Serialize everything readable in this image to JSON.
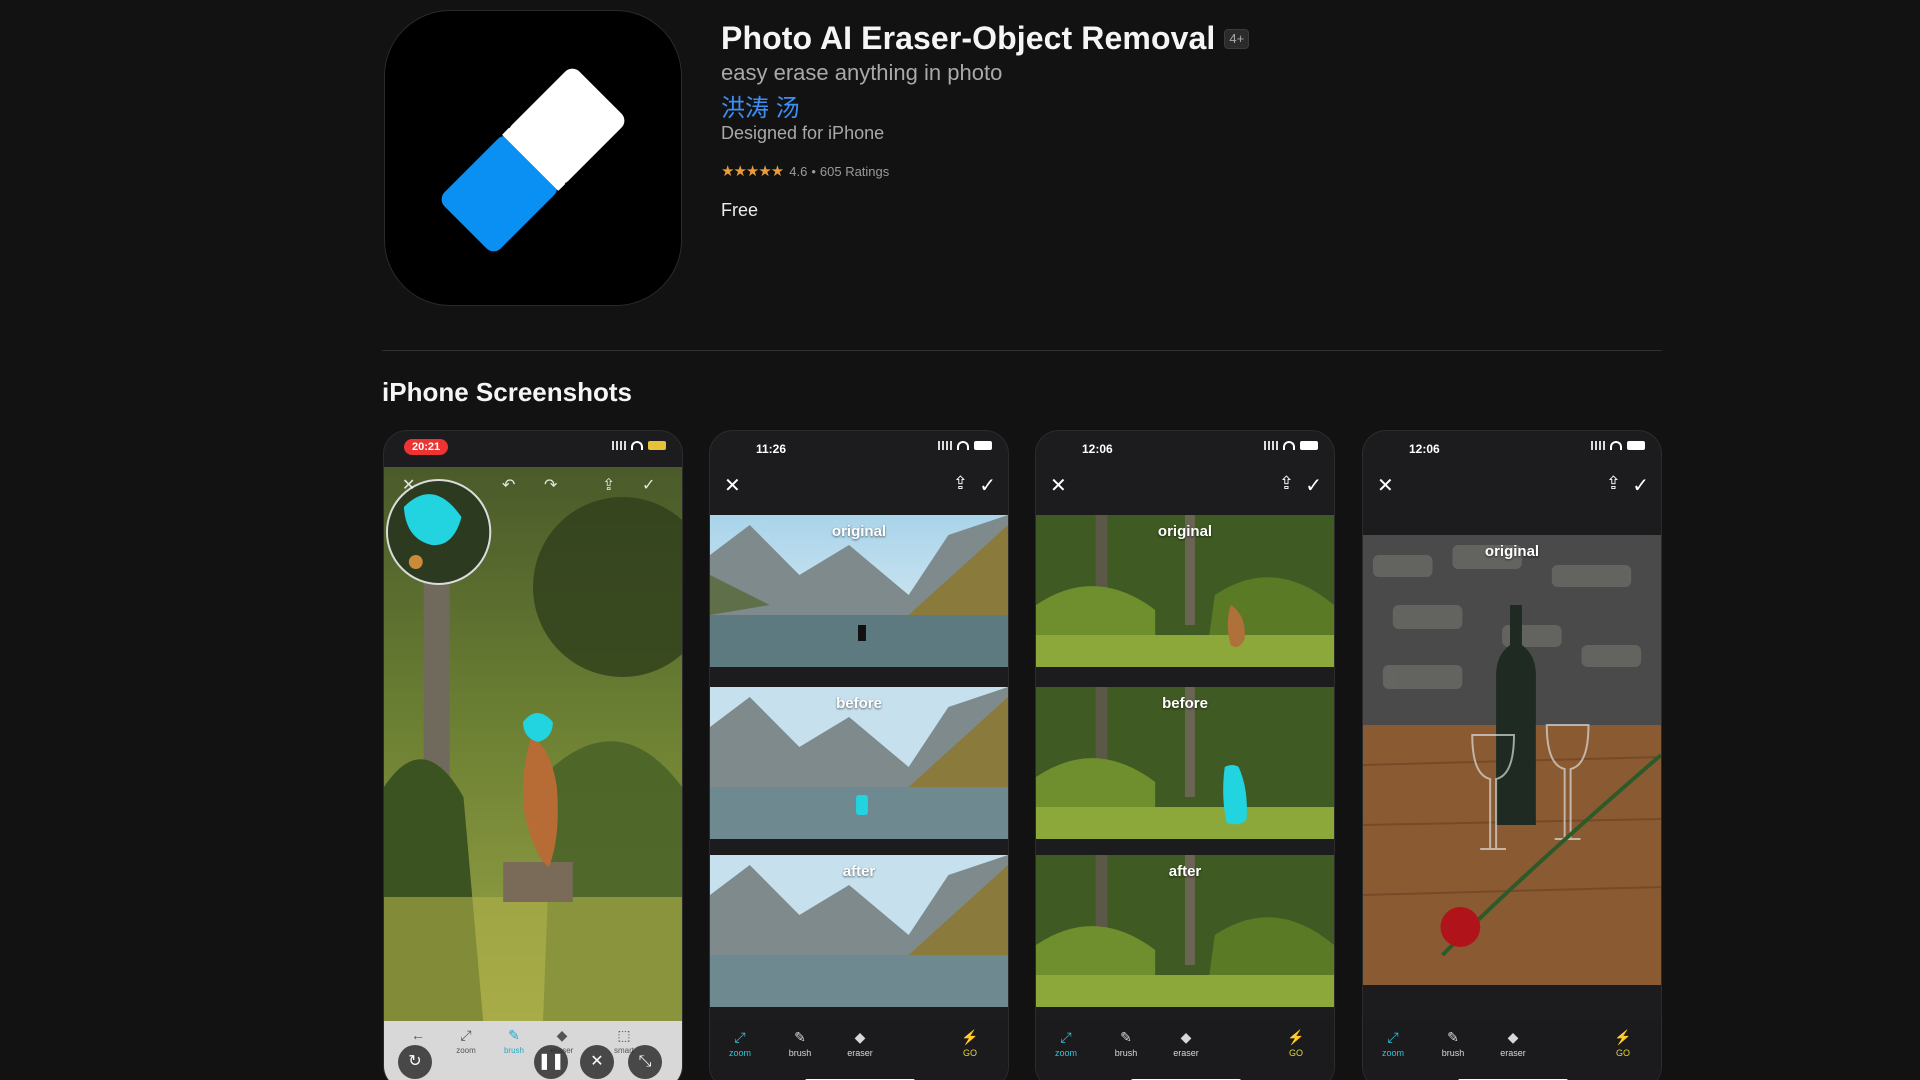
{
  "app": {
    "title": "Photo AI Eraser-Object Removal",
    "age_rating": "4+",
    "subtitle": "easy erase anything in photo",
    "developer": "洪涛 汤",
    "designed_for": "Designed for iPhone",
    "rating_value": "4.6",
    "rating_count": "605 Ratings",
    "stars": "★★★★★",
    "price": "Free",
    "icon_name": "eraser-icon",
    "icon_colors": {
      "blue": "#0a8ff2",
      "white": "#ffffff",
      "background": "#000000"
    }
  },
  "section": {
    "title": "iPhone Screenshots"
  },
  "screenshots": [
    {
      "time": "20:21",
      "toolbar": {
        "undo": "zoom",
        "brush": "brush",
        "eraser": "eraser",
        "smart": "smart"
      }
    },
    {
      "time": "11:26",
      "labels": {
        "original": "original",
        "before": "before",
        "after": "after"
      },
      "toolbar": {
        "zoom": "zoom",
        "brush": "brush",
        "eraser": "eraser",
        "go": "GO"
      }
    },
    {
      "time": "12:06",
      "labels": {
        "original": "original",
        "before": "before",
        "after": "after"
      },
      "toolbar": {
        "zoom": "zoom",
        "brush": "brush",
        "eraser": "eraser",
        "go": "GO"
      }
    },
    {
      "time": "12:06",
      "labels": {
        "original": "original"
      },
      "toolbar": {
        "zoom": "zoom",
        "brush": "brush",
        "eraser": "eraser",
        "go": "GO"
      }
    }
  ],
  "colors": {
    "accent_link": "#3d8ef3",
    "star": "#e89c3a",
    "mask": "#22d3e0",
    "go": "#e6d53a"
  }
}
